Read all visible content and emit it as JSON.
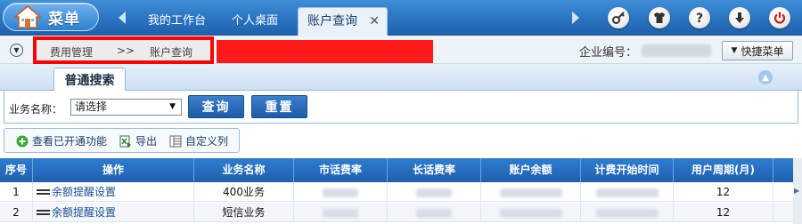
{
  "topbar": {
    "menu_label": "菜单",
    "tabs": [
      {
        "label": "我的工作台"
      },
      {
        "label": "个人桌面"
      },
      {
        "label": "账户查询",
        "active": true
      }
    ],
    "tab_close": "✕",
    "right_icons": [
      "key-icon",
      "shirt-icon",
      "help-icon",
      "download-icon",
      "power-icon"
    ]
  },
  "breadcrumb": {
    "items": [
      "费用管理",
      "账户查询"
    ],
    "separator": ">>"
  },
  "enterprise": {
    "label": "企业编号："
  },
  "quick_menu": {
    "label": "快捷菜单"
  },
  "search": {
    "tab_label": "普通搜索",
    "biz_label": "业务名称：",
    "biz_selected": "请选择",
    "query_label": "查询",
    "reset_label": "重置"
  },
  "toolbar": {
    "view_enabled": "查看已开通功能",
    "export": "导出",
    "custom_columns": "自定义列"
  },
  "grid": {
    "columns": [
      "序号",
      "操作",
      "业务名称",
      "市话费率",
      "长话费率",
      "账户余额",
      "计费开始时间",
      "用户周期(月)",
      "最"
    ],
    "rows": [
      {
        "index": "1",
        "action": "余额提醒设置",
        "biz": "400业务",
        "cycle": "12"
      },
      {
        "index": "2",
        "action": "余额提醒设置",
        "biz": "短信业务",
        "cycle": "12"
      }
    ]
  },
  "colors": {
    "header_blue": "#2a73c1",
    "redaction": "#ff1a1a",
    "highlight_border": "#ff0000"
  }
}
